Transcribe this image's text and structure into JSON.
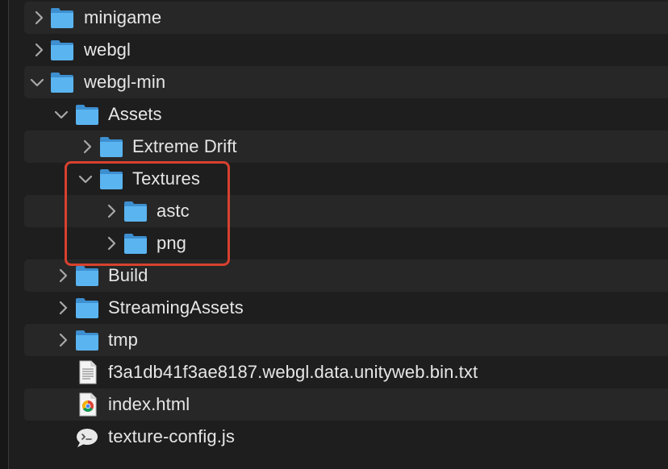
{
  "finder": {
    "items": [
      {
        "label": "minigame",
        "kind": "folder",
        "state": "collapsed"
      },
      {
        "label": "webgl",
        "kind": "folder",
        "state": "collapsed"
      },
      {
        "label": "webgl-min",
        "kind": "folder",
        "state": "expanded"
      },
      {
        "label": "Assets",
        "kind": "folder",
        "state": "expanded"
      },
      {
        "label": "Extreme Drift",
        "kind": "folder",
        "state": "collapsed"
      },
      {
        "label": "Textures",
        "kind": "folder",
        "state": "expanded"
      },
      {
        "label": "astc",
        "kind": "folder",
        "state": "collapsed"
      },
      {
        "label": "png",
        "kind": "folder",
        "state": "collapsed"
      },
      {
        "label": "Build",
        "kind": "folder",
        "state": "collapsed"
      },
      {
        "label": "StreamingAssets",
        "kind": "folder",
        "state": "collapsed"
      },
      {
        "label": "tmp",
        "kind": "folder",
        "state": "collapsed"
      },
      {
        "label": "f3a1db41f3ae8187.webgl.data.unityweb.bin.txt",
        "kind": "text-file-icon"
      },
      {
        "label": "index.html",
        "kind": "chrome-html-icon"
      },
      {
        "label": "texture-config.js",
        "kind": "js-file-icon"
      }
    ]
  },
  "colors": {
    "background": "#1e1e1e",
    "stripe": "#272727",
    "text": "#e6e6e6",
    "chevron": "#a8a8a8",
    "folder_front": "#5ab4f0",
    "folder_back": "#3d8fd0",
    "highlight_border": "#d8412f"
  }
}
